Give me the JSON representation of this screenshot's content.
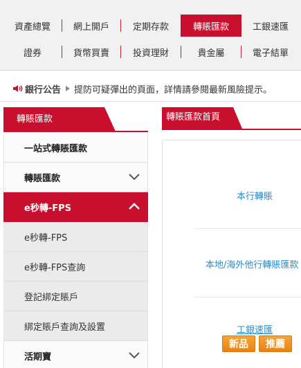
{
  "topnav": {
    "row1": [
      "資產總覽",
      "網上開戶",
      "定期存款",
      "轉賬匯款",
      "工銀速匯"
    ],
    "row2": [
      "證券",
      "貨幣買賣",
      "投資理財",
      "貴金屬",
      "電子結單"
    ],
    "active": "轉賬匯款"
  },
  "announcement": {
    "title": "銀行公告",
    "text": "提防可疑彈出的頁面，詳情請參閱最新風險提示。"
  },
  "sidebar": {
    "header": "轉賬匯款",
    "items": [
      {
        "label": "一站式轉賬匯款",
        "level": 1
      },
      {
        "label": "轉賬匯款",
        "level": 1,
        "expand_icon": "chevron-down-icon"
      },
      {
        "label": "e秒轉-FPS",
        "level": 1,
        "active": true,
        "expand_icon": "chevron-up-icon"
      },
      {
        "label": "e秒轉-FPS",
        "level": 2
      },
      {
        "label": "e秒轉-FPS查詢",
        "level": 2
      },
      {
        "label": "登記綁定賬戶",
        "level": 2
      },
      {
        "label": "綁定賬戶查詢及設置",
        "level": 2
      },
      {
        "label": "活期寶",
        "level": 1,
        "expand_icon": "chevron-down-icon"
      }
    ]
  },
  "content": {
    "tab_title": "轉賬匯款首頁",
    "links": [
      "本行轉賬",
      "本地/海外他行轉賬匯款",
      "工銀速匯"
    ],
    "badges": [
      "新品",
      "推薦"
    ]
  },
  "colors": {
    "brand_red": "#c8102e",
    "link_blue": "#2a8cc8",
    "badge_orange": "#f09a25"
  }
}
